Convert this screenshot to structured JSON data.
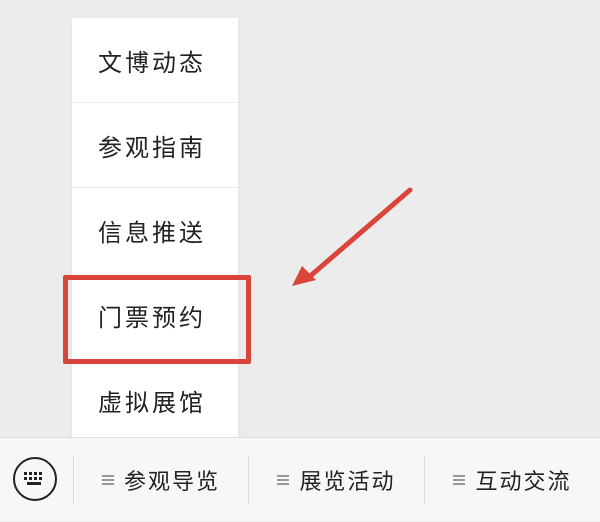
{
  "menu": {
    "items": [
      {
        "label": "文博动态"
      },
      {
        "label": "参观指南"
      },
      {
        "label": "信息推送"
      },
      {
        "label": "门票预约"
      },
      {
        "label": "虚拟展馆"
      }
    ]
  },
  "bottom_bar": {
    "keyboard_icon": "keyboard-icon",
    "items": [
      {
        "label": "参观导览",
        "icon": "hamburger-icon"
      },
      {
        "label": "展览活动",
        "icon": "hamburger-icon"
      },
      {
        "label": "互动交流",
        "icon": "hamburger-icon"
      }
    ]
  },
  "annotation": {
    "highlight_color": "#d9453b",
    "highlighted_item": "门票预约"
  }
}
